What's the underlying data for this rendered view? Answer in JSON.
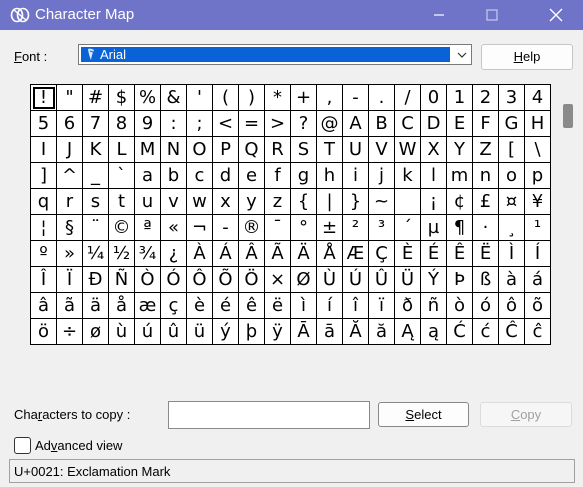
{
  "window": {
    "title": "Character Map",
    "controls": [
      "minimize-icon",
      "maximize-icon",
      "close-icon"
    ]
  },
  "font": {
    "label_pre": "",
    "label_mnemonic": "F",
    "label_post": "ont :",
    "value": "Arial"
  },
  "help_button": {
    "label_mnemonic": "H",
    "label_post": "elp"
  },
  "grid": {
    "selected_index": 0,
    "characters": [
      "!",
      "\"",
      "#",
      "$",
      "%",
      "&",
      "'",
      "(",
      ")",
      "*",
      "+",
      ",",
      "-",
      ".",
      "/",
      "0",
      "1",
      "2",
      "3",
      "4",
      "5",
      "6",
      "7",
      "8",
      "9",
      ":",
      ";",
      "<",
      "=",
      ">",
      "?",
      "@",
      "A",
      "B",
      "C",
      "D",
      "E",
      "F",
      "G",
      "H",
      "I",
      "J",
      "K",
      "L",
      "M",
      "N",
      "O",
      "P",
      "Q",
      "R",
      "S",
      "T",
      "U",
      "V",
      "W",
      "X",
      "Y",
      "Z",
      "[",
      "\\",
      "]",
      "^",
      "_",
      "`",
      "a",
      "b",
      "c",
      "d",
      "e",
      "f",
      "g",
      "h",
      "i",
      "j",
      "k",
      "l",
      "m",
      "n",
      "o",
      "p",
      "q",
      "r",
      "s",
      "t",
      "u",
      "v",
      "w",
      "x",
      "y",
      "z",
      "{",
      "|",
      "}",
      "~",
      " ",
      "¡",
      "¢",
      "£",
      "¤",
      "¥",
      "¦",
      "§",
      "¨",
      "©",
      "ª",
      "«",
      "¬",
      "-",
      "®",
      "¯",
      "°",
      "±",
      "²",
      "³",
      "´",
      "µ",
      "¶",
      "·",
      "¸",
      "¹",
      "º",
      "»",
      "¼",
      "½",
      "¾",
      "¿",
      "À",
      "Á",
      "Â",
      "Ã",
      "Ä",
      "Å",
      "Æ",
      "Ç",
      "È",
      "É",
      "Ê",
      "Ë",
      "Ì",
      "Í",
      "Î",
      "Ï",
      "Ð",
      "Ñ",
      "Ò",
      "Ó",
      "Ô",
      "Õ",
      "Ö",
      "×",
      "Ø",
      "Ù",
      "Ú",
      "Û",
      "Ü",
      "Ý",
      "Þ",
      "ß",
      "à",
      "á",
      "â",
      "ã",
      "ä",
      "å",
      "æ",
      "ç",
      "è",
      "é",
      "ê",
      "ë",
      "ì",
      "í",
      "î",
      "ï",
      "ð",
      "ñ",
      "ò",
      "ó",
      "ô",
      "õ",
      "ö",
      "÷",
      "ø",
      "ù",
      "ú",
      "û",
      "ü",
      "ý",
      "þ",
      "ÿ",
      "Ā",
      "ā",
      "Ă",
      "ă",
      "Ą",
      "ą",
      "Ć",
      "ć",
      "Ĉ",
      "ĉ"
    ]
  },
  "copy": {
    "label_pre": "Cha",
    "label_mnemonic": "r",
    "label_post": "acters to copy :",
    "input_value": ""
  },
  "select_button": {
    "label_mnemonic": "S",
    "label_post": "elect"
  },
  "copy_button": {
    "label_mnemonic": "C",
    "label_post": "opy",
    "enabled": false
  },
  "advanced": {
    "checked": false,
    "label_pre": "Ad",
    "label_mnemonic": "v",
    "label_post": "anced view"
  },
  "status": {
    "text": "U+0021: Exclamation Mark"
  },
  "colors": {
    "titlebar": "#6f74c8",
    "selection": "#0a63d6",
    "window_bg": "#f0f0f0"
  }
}
